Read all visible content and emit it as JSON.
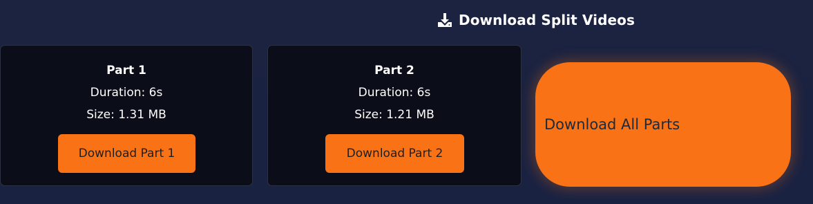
{
  "header": {
    "icon": "download-icon",
    "title": "Download Split Videos"
  },
  "parts": [
    {
      "title": "Part 1",
      "duration": "Duration: 6s",
      "size": "Size: 1.31 MB",
      "button_label": "Download Part 1"
    },
    {
      "title": "Part 2",
      "duration": "Duration: 6s",
      "size": "Size: 1.21 MB",
      "button_label": "Download Part 2"
    }
  ],
  "download_all": {
    "label": "Download All Parts"
  },
  "colors": {
    "background": "#1b2340",
    "card": "#0b0e19",
    "accent": "#f97316"
  }
}
